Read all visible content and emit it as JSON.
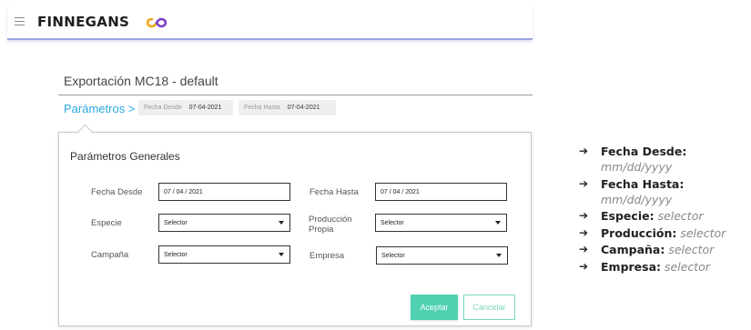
{
  "header": {
    "brand": "FINNEGANS",
    "logo_mark": "infinity-logo",
    "menu_icon": "hamburger-menu-icon"
  },
  "page": {
    "title": "Exportación MC18 - default"
  },
  "breadcrumb": {
    "label": "Parámetros >",
    "chips": [
      {
        "label": "Fecha Desde",
        "value": "07-04-2021"
      },
      {
        "label": "Fecha Hasta",
        "value": "07-04-2021"
      }
    ]
  },
  "panel": {
    "title": "Parámetros Generales",
    "fields": {
      "fecha_desde": {
        "label": "Fecha Desde",
        "value": "07 / 04 / 2021"
      },
      "fecha_hasta": {
        "label": "Fecha Hasta",
        "value": "07 / 04 / 2021"
      },
      "especie": {
        "label": "Especie",
        "value": "Selector"
      },
      "produccion": {
        "label": "Producción Propia",
        "value": "Selector"
      },
      "campana": {
        "label": "Campaña",
        "value": "Selector"
      },
      "empresa": {
        "label": "Empresa",
        "value": "Selector"
      }
    },
    "buttons": {
      "accept": "Aceptar",
      "cancel": "Cancelar"
    }
  },
  "notes": [
    {
      "bullet": "➔",
      "key": "Fecha Desde:",
      "value": "mm/dd/yyyy"
    },
    {
      "bullet": "➔",
      "key": "Fecha Hasta:",
      "value": "mm/dd/yyyy"
    },
    {
      "bullet": "➔",
      "key": "Especie:",
      "value": "selector"
    },
    {
      "bullet": "➔",
      "key": "Producción:",
      "value": "selector"
    },
    {
      "bullet": "➔",
      "key": "Campaña:",
      "value": "selector"
    },
    {
      "bullet": "➔",
      "key": "Empresa:",
      "value": "selector"
    }
  ],
  "colors": {
    "accent": "#29a9e1",
    "accept": "#4fd1b0",
    "header_border": "#9da3dc"
  }
}
